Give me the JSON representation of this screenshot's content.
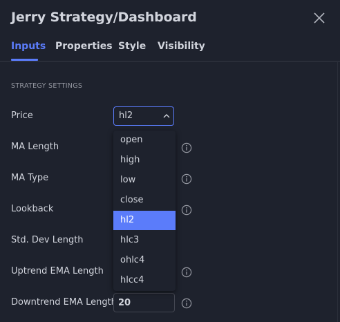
{
  "dialog": {
    "title": "Jerry Strategy/Dashboard"
  },
  "tabs": [
    {
      "label": "Inputs",
      "active": true
    },
    {
      "label": "Properties",
      "active": false
    },
    {
      "label": "Style",
      "active": false
    },
    {
      "label": "Visibility",
      "active": false
    }
  ],
  "section": {
    "title": "STRATEGY SETTINGS"
  },
  "fields": {
    "price": {
      "label": "Price",
      "value": "hl2"
    },
    "ma_length": {
      "label": "MA Length"
    },
    "ma_type": {
      "label": "MA Type"
    },
    "lookback": {
      "label": "Lookback"
    },
    "std_dev_length": {
      "label": "Std. Dev Length"
    },
    "uptrend_ema_length": {
      "label": "Uptrend EMA Length"
    },
    "downtrend_ema_length": {
      "label": "Downtrend EMA Length",
      "value": "20"
    }
  },
  "dropdown": {
    "options": [
      "open",
      "high",
      "low",
      "close",
      "hl2",
      "hlc3",
      "ohlc4",
      "hlcc4"
    ],
    "selected": "hl2"
  },
  "colors": {
    "background": "#1e222d",
    "accent": "#5b7cfa",
    "text": "#d1d4dc",
    "muted": "#9598a1",
    "border": "#434651"
  },
  "icons": {
    "close": "close-icon",
    "chevron": "chevron-up-icon",
    "info": "info-icon"
  }
}
